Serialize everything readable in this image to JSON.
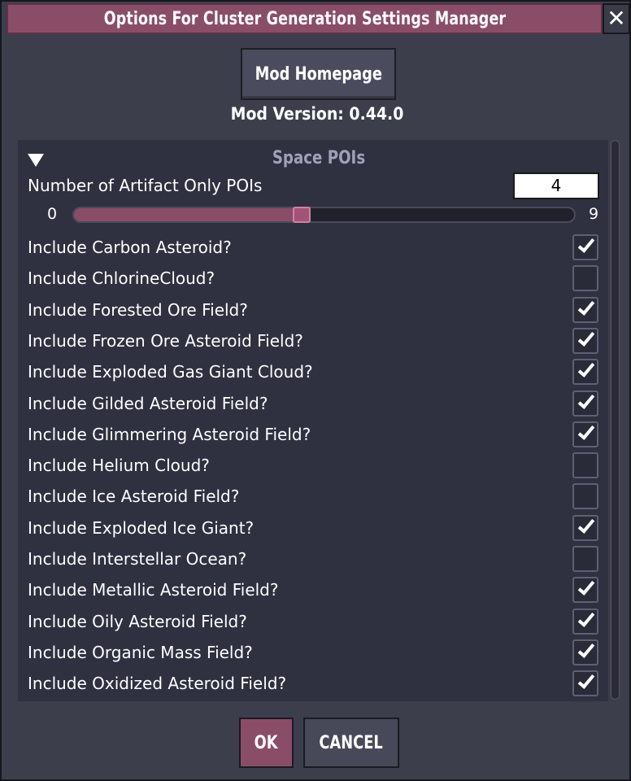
{
  "dialog": {
    "title": "Options For Cluster Generation Settings Manager",
    "close_symbol": "✕",
    "homepage_label": "Mod Homepage",
    "version_text": "Mod Version: 0.44.0",
    "ok_label": "OK",
    "cancel_label": "CANCEL"
  },
  "section": {
    "title": "Space POIs",
    "collapse_icon": "triangle-down-icon"
  },
  "artifact": {
    "label": "Number of Artifact Only POIs",
    "value": "4",
    "min": "0",
    "max": "9"
  },
  "checkboxes": [
    {
      "label": "Include Carbon Asteroid?",
      "checked": true
    },
    {
      "label": "Include ChlorineCloud?",
      "checked": false
    },
    {
      "label": "Include Forested Ore Field?",
      "checked": true
    },
    {
      "label": "Include Frozen Ore Asteroid Field?",
      "checked": true
    },
    {
      "label": "Include Exploded Gas Giant Cloud?",
      "checked": true
    },
    {
      "label": "Include Gilded Asteroid Field?",
      "checked": true
    },
    {
      "label": "Include Glimmering Asteroid Field?",
      "checked": true
    },
    {
      "label": "Include Helium Cloud?",
      "checked": false
    },
    {
      "label": "Include Ice Asteroid Field?",
      "checked": false
    },
    {
      "label": "Include Exploded Ice Giant?",
      "checked": true
    },
    {
      "label": "Include Interstellar Ocean?",
      "checked": false
    },
    {
      "label": "Include Metallic Asteroid Field?",
      "checked": true
    },
    {
      "label": "Include Oily Asteroid Field?",
      "checked": true
    },
    {
      "label": "Include Organic Mass Field?",
      "checked": true
    },
    {
      "label": "Include Oxidized Asteroid Field?",
      "checked": true
    }
  ],
  "colors": {
    "accent": "#8a4d68",
    "panel": "#2f3040",
    "dialog": "#3d3e4c"
  }
}
